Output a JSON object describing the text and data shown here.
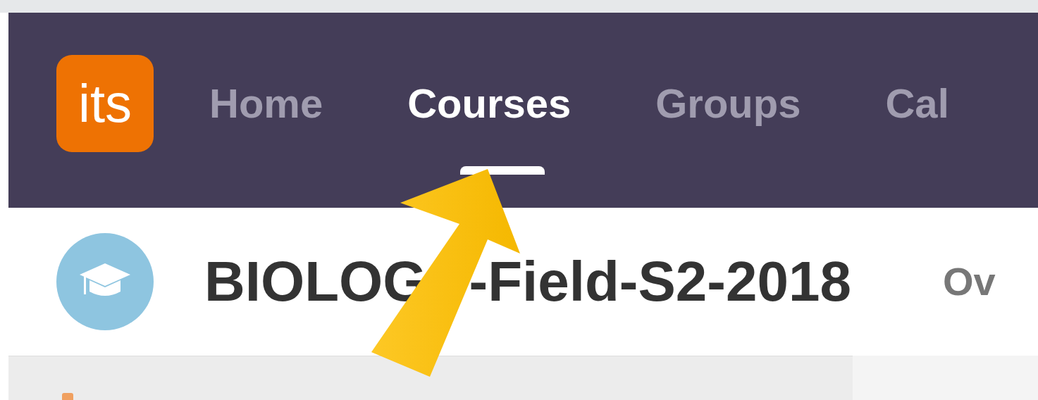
{
  "logo": {
    "text": "its"
  },
  "nav": [
    {
      "label": "Home",
      "selected": false
    },
    {
      "label": "Courses",
      "selected": true
    },
    {
      "label": "Groups",
      "selected": false
    },
    {
      "label": "Cal",
      "selected": false
    }
  ],
  "course": {
    "title_parts": [
      "BIOLOG",
      "-Field-S2-2018"
    ],
    "next_link": "Ov"
  }
}
